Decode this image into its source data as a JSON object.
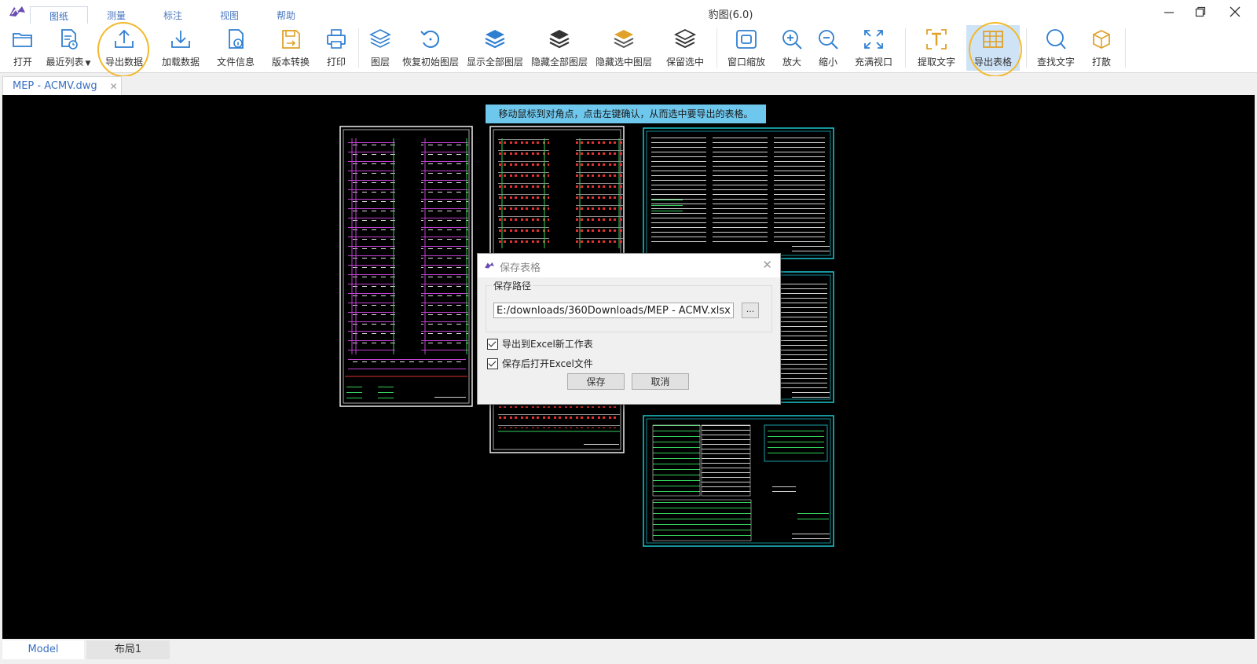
{
  "app": {
    "title": "豹图(6.0)"
  },
  "menu_tabs": [
    {
      "label": "图纸",
      "active": true
    },
    {
      "label": "测量",
      "active": false
    },
    {
      "label": "标注",
      "active": false
    },
    {
      "label": "视图",
      "active": false
    },
    {
      "label": "帮助",
      "active": false
    }
  ],
  "toolbar": {
    "open": "打开",
    "recent": "最近列表",
    "export_data": "导出数据",
    "load_data": "加载数据",
    "file_info": "文件信息",
    "version_convert": "版本转换",
    "print": "打印",
    "layers": "图层",
    "restore_layers": "恢复初始图层",
    "show_all_layers": "显示全部图层",
    "hide_all_layers": "隐藏全部图层",
    "hide_selected_layers": "隐藏选中图层",
    "keep_selected": "保留选中",
    "window_zoom": "窗口缩放",
    "zoom_in": "放大",
    "zoom_out": "缩小",
    "fit_view": "充满视口",
    "extract_text": "提取文字",
    "export_table": "导出表格",
    "find_text": "查找文字",
    "explode": "打散"
  },
  "document_tab": {
    "name": "MEP - ACMV.dwg",
    "close": "✕"
  },
  "canvas": {
    "hint": "移动鼠标到对角点，点击左键确认，从而选中要导出的表格。"
  },
  "layout_tabs": [
    {
      "label": "Model",
      "active": true
    },
    {
      "label": "布局1",
      "active": false
    }
  ],
  "dialog": {
    "title": "保存表格",
    "group_label": "保存路径",
    "path_value": "E:/downloads/360Downloads/MEP - ACMV.xlsx",
    "browse": "...",
    "option_new_sheet": "导出到Excel新工作表",
    "option_new_sheet_checked": true,
    "option_open_after": "保存后打开Excel文件",
    "option_open_after_checked": true,
    "save": "保存",
    "cancel": "取消"
  },
  "colors": {
    "accent": "#3a6fc4",
    "highlight_circle": "#f2b92b",
    "hint_bg": "#6ec7ec",
    "canvas_bg": "#000000"
  }
}
